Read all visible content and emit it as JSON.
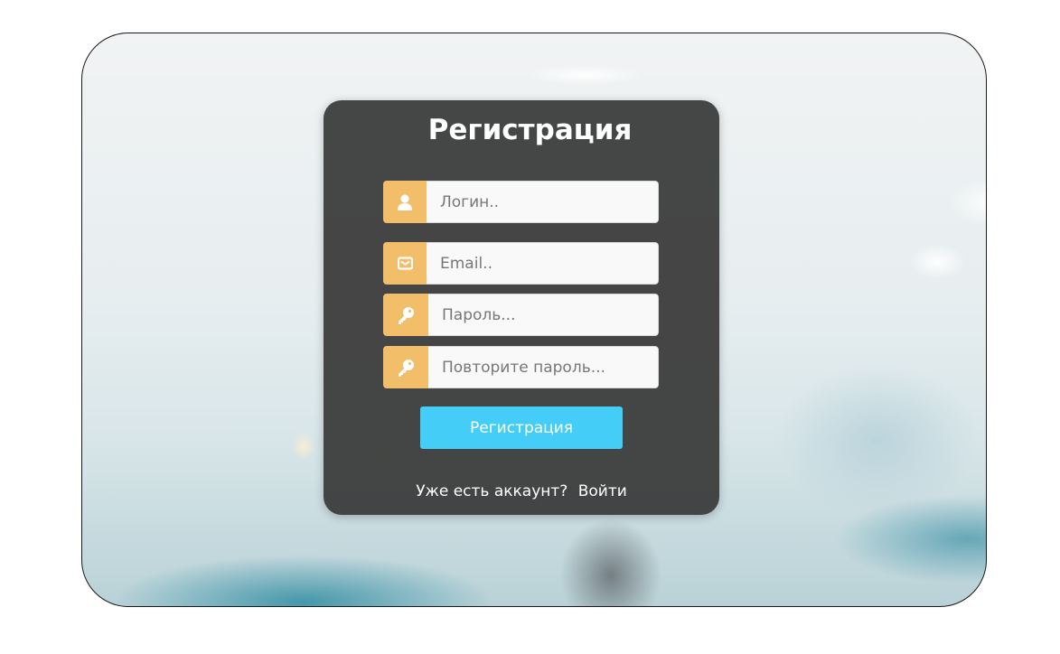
{
  "form": {
    "title": "Регистрация",
    "fields": [
      {
        "icon": "user-icon",
        "placeholder": "Логин.."
      },
      {
        "icon": "envelope-icon",
        "placeholder": "Email.."
      },
      {
        "icon": "key-icon",
        "placeholder": "Пароль..."
      },
      {
        "icon": "key-icon",
        "placeholder": "Повторите пароль..."
      }
    ],
    "submit_label": "Регистрация",
    "login_prompt": "Уже есть аккаунт?",
    "login_link": "Войти"
  },
  "colors": {
    "card": "#3a3a3a",
    "icon_box": "#f2be69",
    "button": "#44cdf7"
  }
}
